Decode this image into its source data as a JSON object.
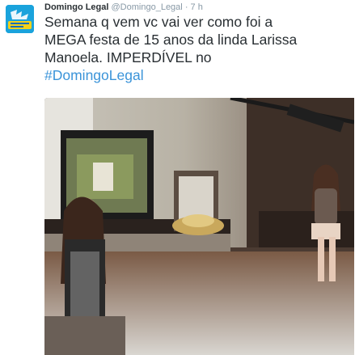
{
  "tweet": {
    "author_name": "Domingo Legal",
    "handle": "@Domingo_Legal",
    "separator": "·",
    "time": "7 h",
    "avatar_text": "Domingo Legal",
    "text_lines": [
      "Semana q vem vc vai ver como foi a",
      "MEGA festa de 15 anos da linda Larissa",
      "Manoela. IMPERDÍVEL no"
    ],
    "hashtag": "#DomingoLegal"
  },
  "colors": {
    "name": "#292f33",
    "meta": "#8899a6",
    "hashtag": "#3b94d9",
    "avatar_bg": "#1aa3dc"
  }
}
